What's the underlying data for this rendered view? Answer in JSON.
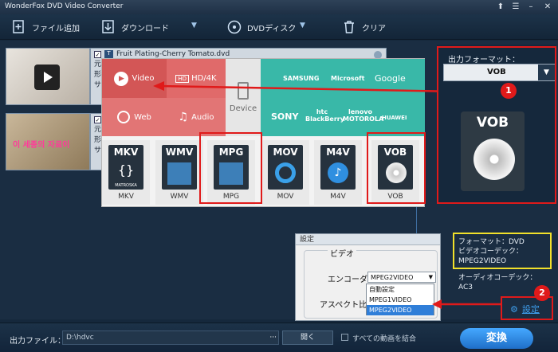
{
  "app": {
    "title": "WonderFox DVD Video Converter"
  },
  "toolbar": {
    "add_file": "ファイル追加",
    "download": "ダウンロード",
    "dvd_disc": "DVDディスク",
    "clear": "クリア"
  },
  "items": [
    {
      "title": "Fruit Plating-Cherry Tomato.dvd",
      "line1": "元フ",
      "line2": "形式",
      "line3": "サイ"
    },
    {
      "title": "",
      "line1": "元フ",
      "line2": "形式",
      "line3": "サイ",
      "overlay": "이 세종의 자료이"
    }
  ],
  "format_panel": {
    "categories": {
      "video": "Video",
      "hd": "HD/4K",
      "web": "Web",
      "audio": "Audio",
      "device": "Device"
    },
    "brands": [
      "SAMSUNG",
      "Microsoft",
      "Google",
      "SONY",
      "htc BlackBerry",
      "lenovo MOTOROLA",
      "HUAWEI"
    ],
    "formats": [
      {
        "box": "MKV",
        "label": "MKV",
        "sub": "MATROSKA"
      },
      {
        "box": "WMV",
        "label": "WMV"
      },
      {
        "box": "MPG",
        "label": "MPG"
      },
      {
        "box": "MOV",
        "label": "MOV"
      },
      {
        "box": "M4V",
        "label": "M4V"
      },
      {
        "box": "VOB",
        "label": "VOB"
      }
    ]
  },
  "output_format": {
    "heading": "出力フォーマット：",
    "selected": "VOB",
    "preview": "VOB"
  },
  "annotations": {
    "badge1": "1",
    "badge2": "2"
  },
  "info": {
    "format": "フォーマット：DVD",
    "vcodec_label": "ビデオコーデック：",
    "vcodec_value": "MPEG2VIDEO",
    "acodec_label": "オーディオコーデック：",
    "acodec_value": "AC3"
  },
  "settings_link": "設定",
  "settings_dialog": {
    "title": "設定",
    "section": "ビデオ",
    "encoder_label": "エンコーダ",
    "encoder_value": "MPEG2VIDEO",
    "aspect_label": "アスペクト比",
    "options": [
      "自動設定",
      "MPEG1VIDEO",
      "MPEG2VIDEO"
    ]
  },
  "bottom": {
    "output_label": "出力ファイル：",
    "output_path": "D:\\hdvc",
    "browse": "···",
    "open": "開く",
    "merge": "すべての動画を結合",
    "convert": "変換"
  },
  "colors": {
    "red": "#e01a1a",
    "yellow": "#f1e02a",
    "accent": "#2e8de0"
  }
}
